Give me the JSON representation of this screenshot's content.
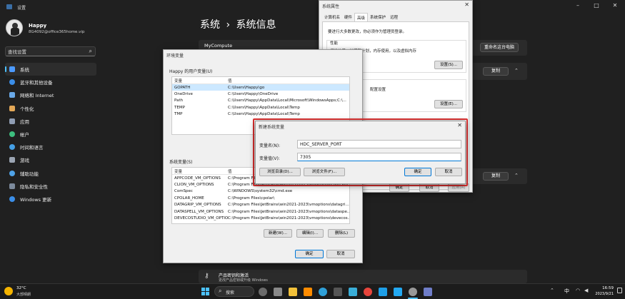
{
  "settings": {
    "title": "设置",
    "user": {
      "name": "Happy",
      "email": "8G4092@office365home.vip"
    },
    "search_placeholder": "查找设置",
    "nav": [
      {
        "label": "系统",
        "icon": "monitor-icon",
        "color": "#4c9aff",
        "active": true
      },
      {
        "label": "蓝牙和其他设备",
        "icon": "bluetooth-icon",
        "color": "#3b8ee8",
        "active": false
      },
      {
        "label": "网络和 Internet",
        "icon": "wifi-icon",
        "color": "#6aa9e8",
        "active": false
      },
      {
        "label": "个性化",
        "icon": "brush-icon",
        "color": "#e3a857",
        "active": false
      },
      {
        "label": "应用",
        "icon": "apps-icon",
        "color": "#8f9db3",
        "active": false
      },
      {
        "label": "帐户",
        "icon": "account-icon",
        "color": "#3dbf7f",
        "active": false
      },
      {
        "label": "时间和语言",
        "icon": "globe-icon",
        "color": "#45a0e6",
        "active": false
      },
      {
        "label": "游戏",
        "icon": "game-icon",
        "color": "#9ba5b3",
        "active": false
      },
      {
        "label": "辅助功能",
        "icon": "accessibility-icon",
        "color": "#4fa3e8",
        "active": false
      },
      {
        "label": "隐私和安全性",
        "icon": "shield-icon",
        "color": "#7c8a9c",
        "active": false
      },
      {
        "label": "Windows 更新",
        "icon": "update-icon",
        "color": "#3b8ee8",
        "active": false
      }
    ],
    "breadcrumb": {
      "parent": "系统",
      "separator": "›",
      "current": "系统信息"
    },
    "device_name": "MyCompute",
    "rename_button": "重命名这台电脑",
    "copy_button_1": "复制",
    "copy_button_2": "复制",
    "product_key": {
      "title": "产品密钥和激活",
      "subtitle": "更改产品密钥或升级 Windows"
    }
  },
  "sysprops": {
    "title": "系统属性",
    "tabs": [
      "计算机名",
      "硬件",
      "高级",
      "系统保护",
      "远程"
    ],
    "active_tab": "高级",
    "admin_note": "要进行大多数更改，你必须作为管理员登录。",
    "perf_title": "性能",
    "perf_desc": "视觉效果，处理器计划，内存使用，以及虚拟内存",
    "settings_button_1": "设置(S)...",
    "profile_title": "置文件",
    "profile_desc": "配置设置",
    "settings_button_2": "设置(E)...",
    "ok": "确定",
    "cancel": "取消",
    "apply": "应用(A)"
  },
  "envvars": {
    "title": "环境变量",
    "user_section": "Happy 的用户变量(U)",
    "col_var": "变量",
    "col_val": "值",
    "user_vars": [
      {
        "name": "GOPATH",
        "value": "C:\\Users\\Happy\\go",
        "selected": true
      },
      {
        "name": "OneDrive",
        "value": "C:\\Users\\Happy\\OneDrive",
        "selected": false
      },
      {
        "name": "Path",
        "value": "C:\\Users\\Happy\\AppData\\Local\\Microsoft\\WindowsApps;C:\\...",
        "selected": false
      },
      {
        "name": "TEMP",
        "value": "C:\\Users\\Happy\\AppData\\Local\\Temp",
        "selected": false
      },
      {
        "name": "TMP",
        "value": "C:\\Users\\Happy\\AppData\\Local\\Temp",
        "selected": false
      }
    ],
    "sys_section": "系统变量(S)",
    "sys_vars": [
      {
        "name": "APPCODE_VM_OPTIONS",
        "value": "C:\\Program Files\\JetBrains\\win2021-2023\\vmoptions\\appcode...",
        "selected": false
      },
      {
        "name": "CLION_VM_OPTIONS",
        "value": "C:\\Program Files\\JetBrains\\win2021-2023\\vmoptions\\clion.vm...",
        "selected": false
      },
      {
        "name": "ComSpec",
        "value": "C:\\WINDOWS\\system32\\cmd.exe",
        "selected": false
      },
      {
        "name": "CPOLAR_HOME",
        "value": "C:\\Program Files\\cpolar\\",
        "selected": false
      },
      {
        "name": "DATAGRIP_VM_OPTIONS",
        "value": "C:\\Program Files\\JetBrains\\win2021-2023\\vmoptions\\datagri...",
        "selected": false
      },
      {
        "name": "DATASPELL_VM_OPTIONS",
        "value": "C:\\Program Files\\JetBrains\\win2021-2023\\vmoptions\\dataspe...",
        "selected": false
      },
      {
        "name": "DEVECOSTUDIO_VM_OPTIONS",
        "value": "C:\\Program Files\\JetBrains\\win2021-2023\\vmoptions\\devecos...",
        "selected": false
      }
    ],
    "new_button": "新建(W)...",
    "edit_button": "编辑(I)...",
    "delete_button": "删除(L)",
    "ok": "确定",
    "cancel": "取消"
  },
  "newvar": {
    "title": "新建系统变量",
    "name_label": "变量名(N):",
    "name_value": "HDC_SERVER_PORT",
    "value_label": "变量值(V):",
    "value_value": "7305",
    "browse_dir": "浏览目录(D)...",
    "browse_file": "浏览文件(F)...",
    "ok": "确定",
    "cancel": "取消",
    "highlight_color": "#e03030"
  },
  "taskbar": {
    "weather_temp": "32°C",
    "weather_desc": "大部晴朗",
    "search_label": "搜索",
    "lang": "中",
    "time": "16:59",
    "date": "2023/9/21"
  }
}
